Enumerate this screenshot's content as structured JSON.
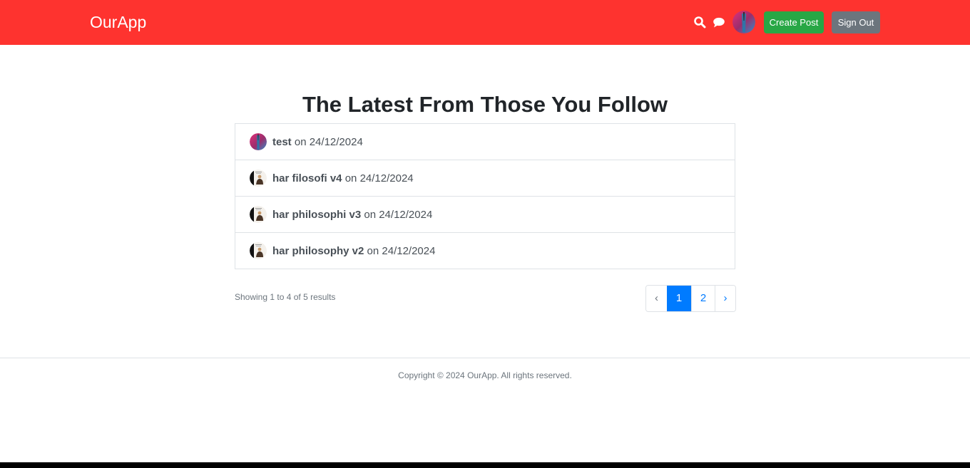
{
  "header": {
    "brand": "OurApp",
    "search_icon": "search-icon",
    "chat_icon": "chat-icon",
    "create_post_label": "Create Post",
    "sign_out_label": "Sign Out",
    "bg_color": "#fe332f"
  },
  "main": {
    "title": "The Latest From Those You Follow",
    "posts": [
      {
        "title": "test",
        "date_prefix": " on ",
        "date": "24/12/2024",
        "avatar": "gradient-avatar"
      },
      {
        "title": "har filosofi v4",
        "date_prefix": " on ",
        "date": "24/12/2024",
        "avatar": "photo-avatar"
      },
      {
        "title": "har philosophi v3",
        "date_prefix": " on ",
        "date": "24/12/2024",
        "avatar": "photo-avatar"
      },
      {
        "title": "har philosophy v2",
        "date_prefix": " on ",
        "date": "24/12/2024",
        "avatar": "photo-avatar"
      }
    ],
    "results_text": "Showing 1 to 4 of 5 results",
    "pagination": {
      "prev": "‹",
      "pages": [
        "1",
        "2"
      ],
      "current": "1",
      "next": "›"
    }
  },
  "footer": {
    "copyright": "Copyright © 2024 OurApp. All rights reserved."
  },
  "colors": {
    "accent": "#fe332f",
    "create_button": "#28a745",
    "sign_out_button": "#6c757d",
    "active_page": "#007bff"
  }
}
